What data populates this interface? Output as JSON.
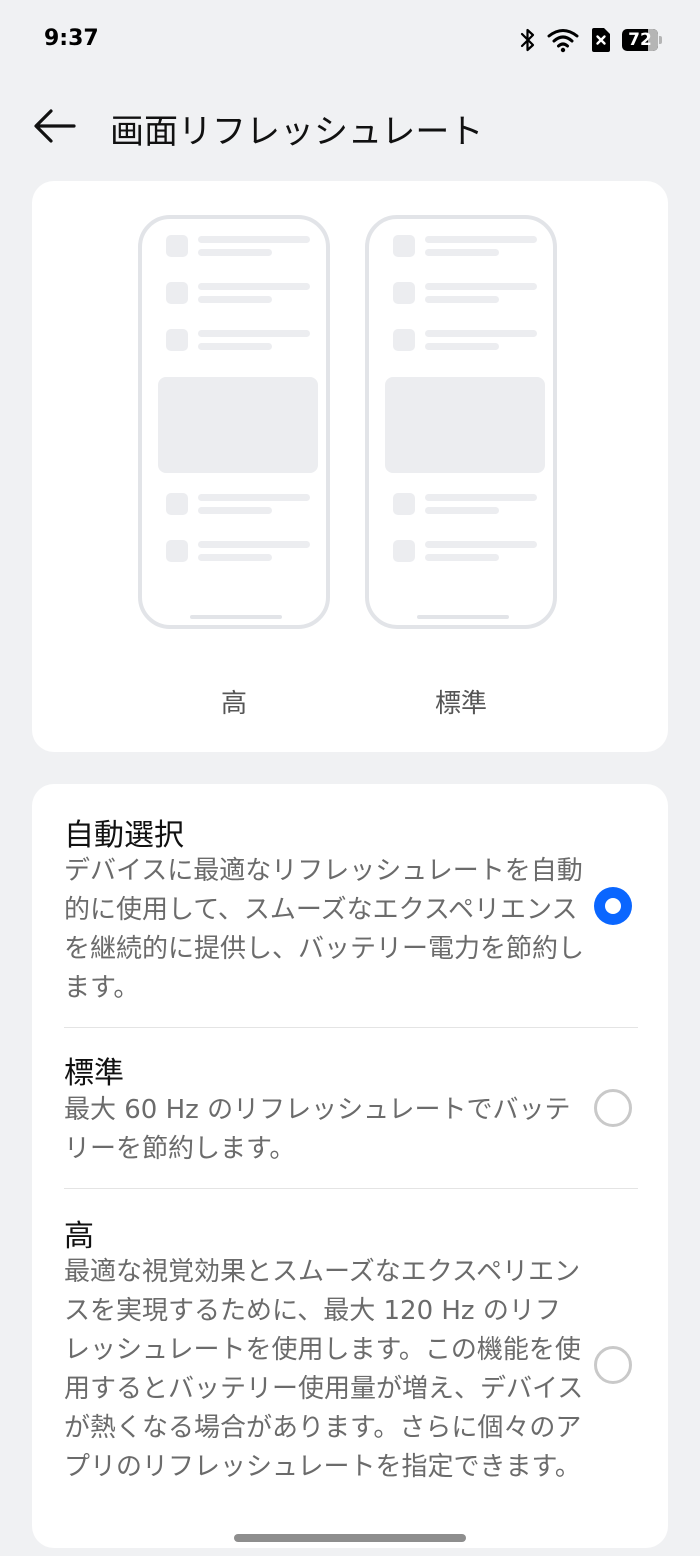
{
  "status_bar": {
    "time": "9:37",
    "battery_level": 72,
    "icons": [
      "bluetooth-icon",
      "wifi-icon",
      "sim-x-icon",
      "battery-icon"
    ]
  },
  "header": {
    "back_icon": "arrow-left-icon",
    "title": "画面リフレッシュレート"
  },
  "preview": {
    "left_label": "高",
    "right_label": "標準"
  },
  "options": [
    {
      "title": "自動選択",
      "description": "デバイスに最適なリフレッシュレートを自動的に使用して、スムーズなエクスペリエンスを継続的に提供し、バッテリー電力を節約します。",
      "selected": true
    },
    {
      "title": "標準",
      "description": "最大 60 Hz のリフレッシュレートでバッテリーを節約します。",
      "selected": false
    },
    {
      "title": "高",
      "description": "最適な視覚効果とスムーズなエクスペリエンスを実現するために、最大 120 Hz のリフレッシュレートを使用します。この機能を使用するとバッテリー使用量が増え、デバイスが熱くなる場合があります。さらに個々のアプリのリフレッシュレートを指定できます。",
      "selected": false
    }
  ],
  "colors": {
    "accent": "#0a66ff",
    "background": "#f0f1f3",
    "card": "#ffffff"
  }
}
